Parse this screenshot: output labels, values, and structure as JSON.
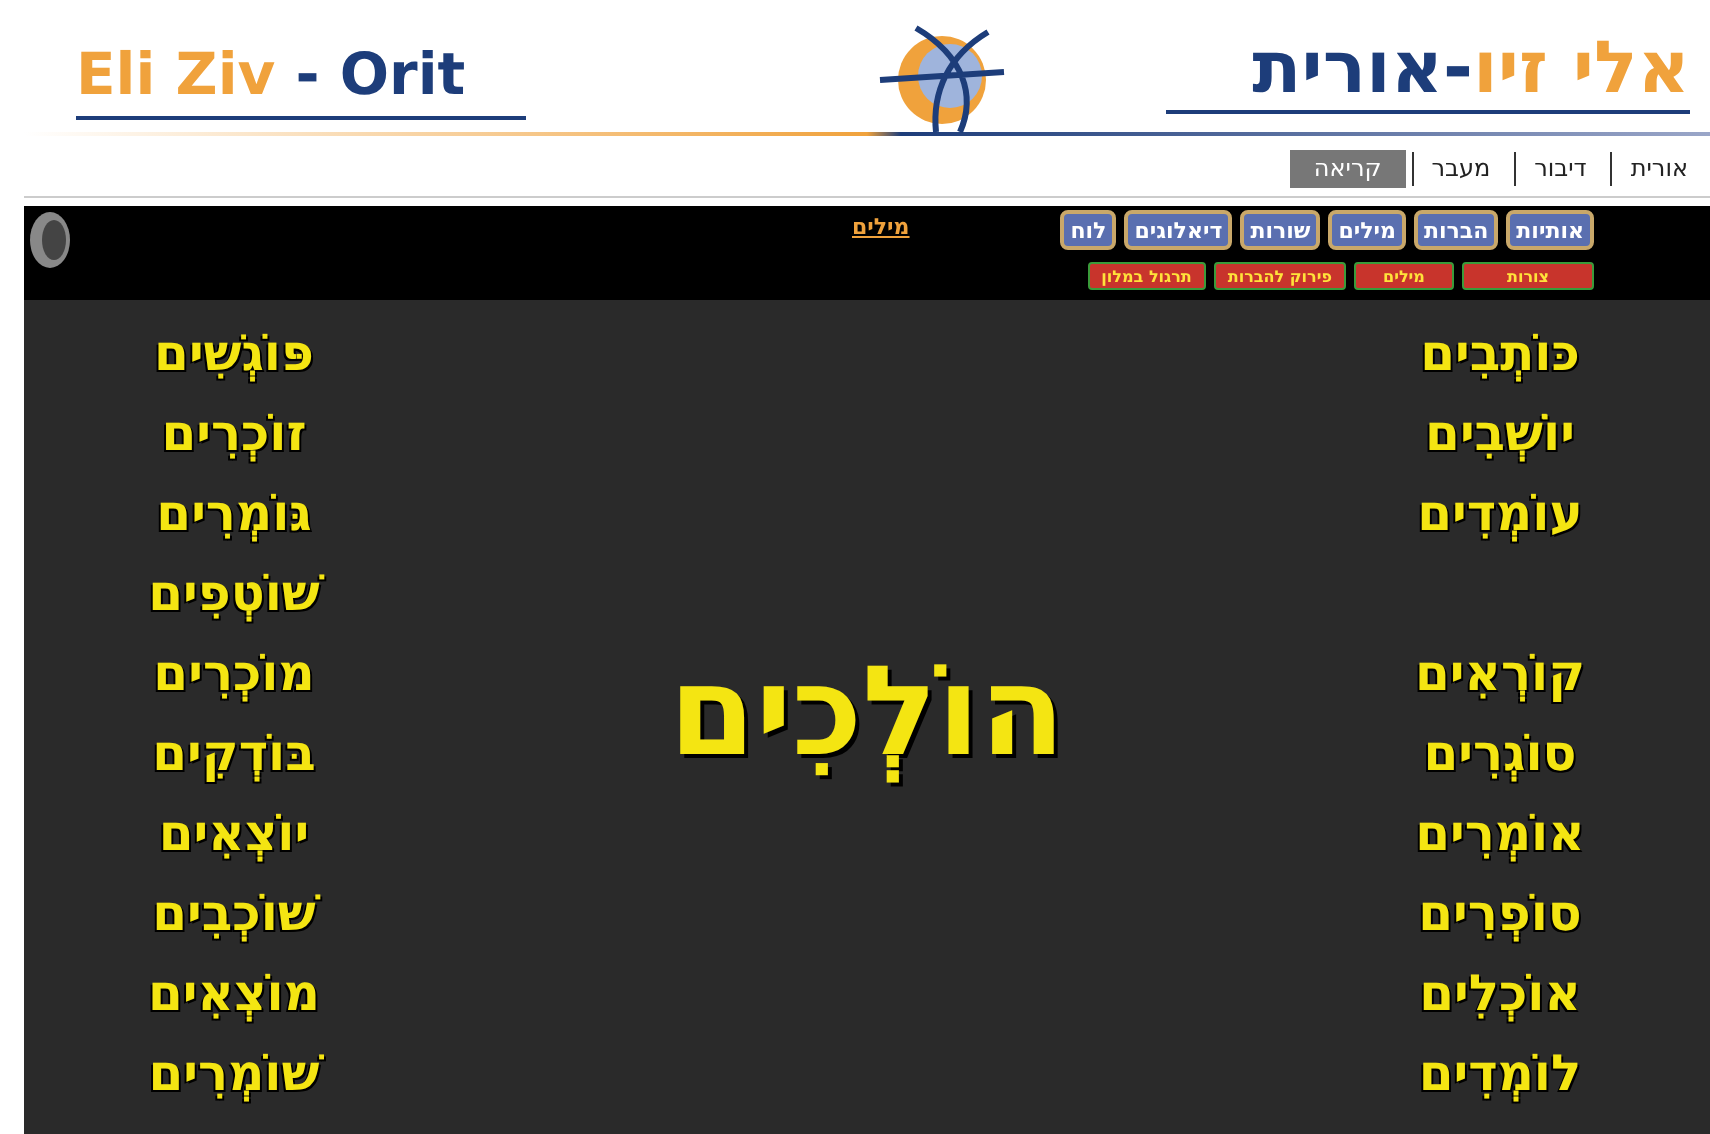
{
  "header": {
    "logo_latin": {
      "first": "Eli Ziv",
      "second": "- Orit"
    },
    "logo_hebrew": {
      "first": "אלי זיו",
      "second": "-אורית"
    }
  },
  "nav_tabs": [
    {
      "label": "אורית",
      "selected": false
    },
    {
      "label": "דיבור",
      "selected": false
    },
    {
      "label": "מעבר",
      "selected": false
    },
    {
      "label": "קריאה",
      "selected": true
    }
  ],
  "toolbar": {
    "link": "מילים",
    "main_buttons": [
      "אותיות",
      "הברות",
      "מילים",
      "שורות",
      "דיאלוגים",
      "לוח"
    ],
    "sub_buttons": [
      "צורות",
      "מילים",
      "פירוק להברות",
      "תרגול במלון"
    ]
  },
  "lesson": {
    "center_word": "הוֹלְכִים",
    "right_column": [
      {
        "words": [
          "כּוֹתְבִים",
          "יוֹשְׁבִים",
          "עוֹמְדִים"
        ]
      },
      {
        "words": [
          "קוֹרְאִים",
          "סוֹגְרִים",
          "אוֹמְרִים",
          "סוֹפְרִים",
          "אוֹכְלִים",
          "לוֹמְדִים"
        ]
      }
    ],
    "left_column": [
      {
        "words": [
          "פּוֹגְשִׁים",
          "זוֹכְרִים",
          "גּוֹמְרִים",
          "שׁוֹטְפִים",
          "מוֹכְרִים",
          "בּוֹדְקִים",
          "יוֹצְאִים",
          "שׁוֹכְבִים",
          "מוֹצְאִים",
          "שׁוֹמְרִים"
        ]
      }
    ]
  }
}
